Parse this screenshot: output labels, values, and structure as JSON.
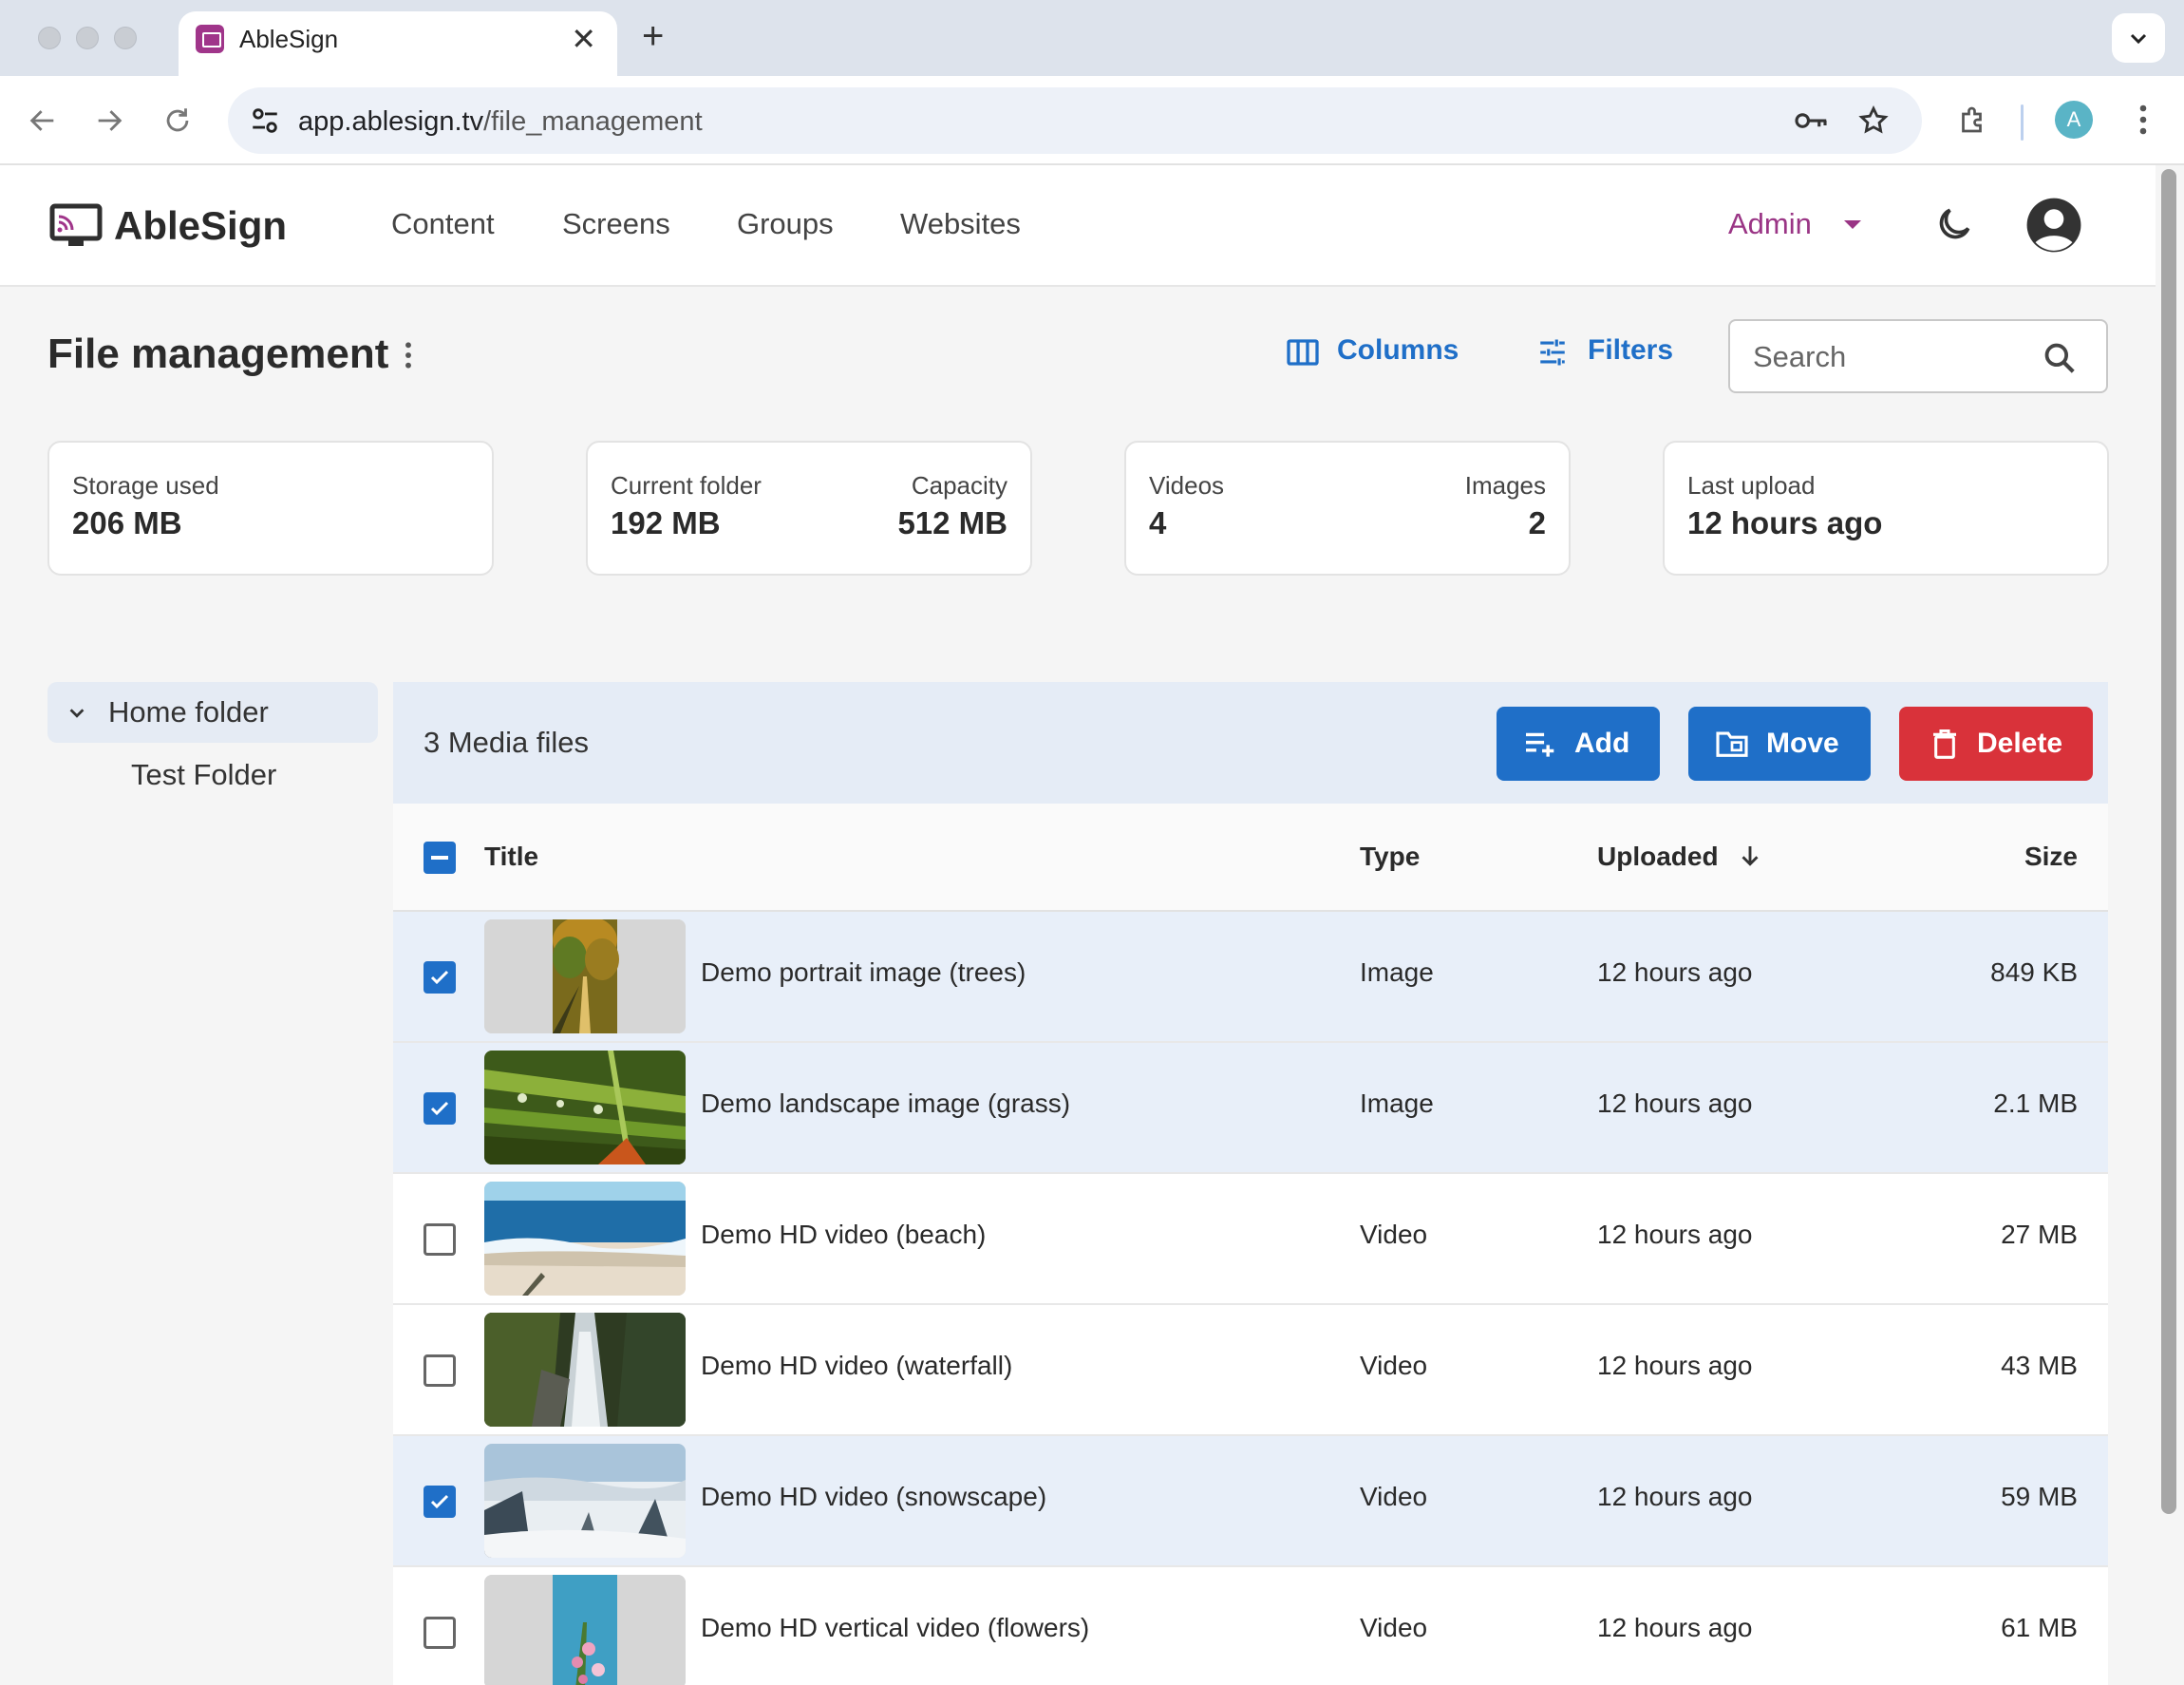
{
  "browser": {
    "tab_title": "AbleSign",
    "url_host": "app.ablesign.tv",
    "url_path": "/file_management",
    "profile_initial": "A"
  },
  "header": {
    "brand": "AbleSign",
    "nav": [
      "Content",
      "Screens",
      "Groups",
      "Websites"
    ],
    "role": "Admin"
  },
  "page": {
    "title": "File management",
    "columns_label": "Columns",
    "filters_label": "Filters",
    "search_placeholder": "Search"
  },
  "stats": {
    "storage_used_label": "Storage used",
    "storage_used_value": "206 MB",
    "current_folder_label": "Current folder",
    "current_folder_value": "192 MB",
    "capacity_label": "Capacity",
    "capacity_value": "512 MB",
    "videos_label": "Videos",
    "videos_value": "4",
    "images_label": "Images",
    "images_value": "2",
    "last_upload_label": "Last upload",
    "last_upload_value": "12 hours ago"
  },
  "folders": {
    "home": "Home folder",
    "children": [
      "Test Folder"
    ]
  },
  "table": {
    "count_label": "3 Media files",
    "add_label": "Add",
    "move_label": "Move",
    "delete_label": "Delete",
    "columns": {
      "title": "Title",
      "type": "Type",
      "uploaded": "Uploaded",
      "size": "Size"
    },
    "rows": [
      {
        "title": "Demo portrait image (trees)",
        "type": "Image",
        "uploaded": "12 hours ago",
        "size": "849 KB",
        "selected": true
      },
      {
        "title": "Demo landscape image (grass)",
        "type": "Image",
        "uploaded": "12 hours ago",
        "size": "2.1 MB",
        "selected": true
      },
      {
        "title": "Demo HD video (beach)",
        "type": "Video",
        "uploaded": "12 hours ago",
        "size": "27 MB",
        "selected": false
      },
      {
        "title": "Demo HD video (waterfall)",
        "type": "Video",
        "uploaded": "12 hours ago",
        "size": "43 MB",
        "selected": false
      },
      {
        "title": "Demo HD video (snowscape)",
        "type": "Video",
        "uploaded": "12 hours ago",
        "size": "59 MB",
        "selected": true
      },
      {
        "title": "Demo HD vertical video (flowers)",
        "type": "Video",
        "uploaded": "12 hours ago",
        "size": "61 MB",
        "selected": false
      }
    ]
  },
  "colors": {
    "primary": "#1f6fc8",
    "danger": "#d9323a",
    "brand_accent": "#9a3585",
    "selected_row": "#e8eff9"
  }
}
